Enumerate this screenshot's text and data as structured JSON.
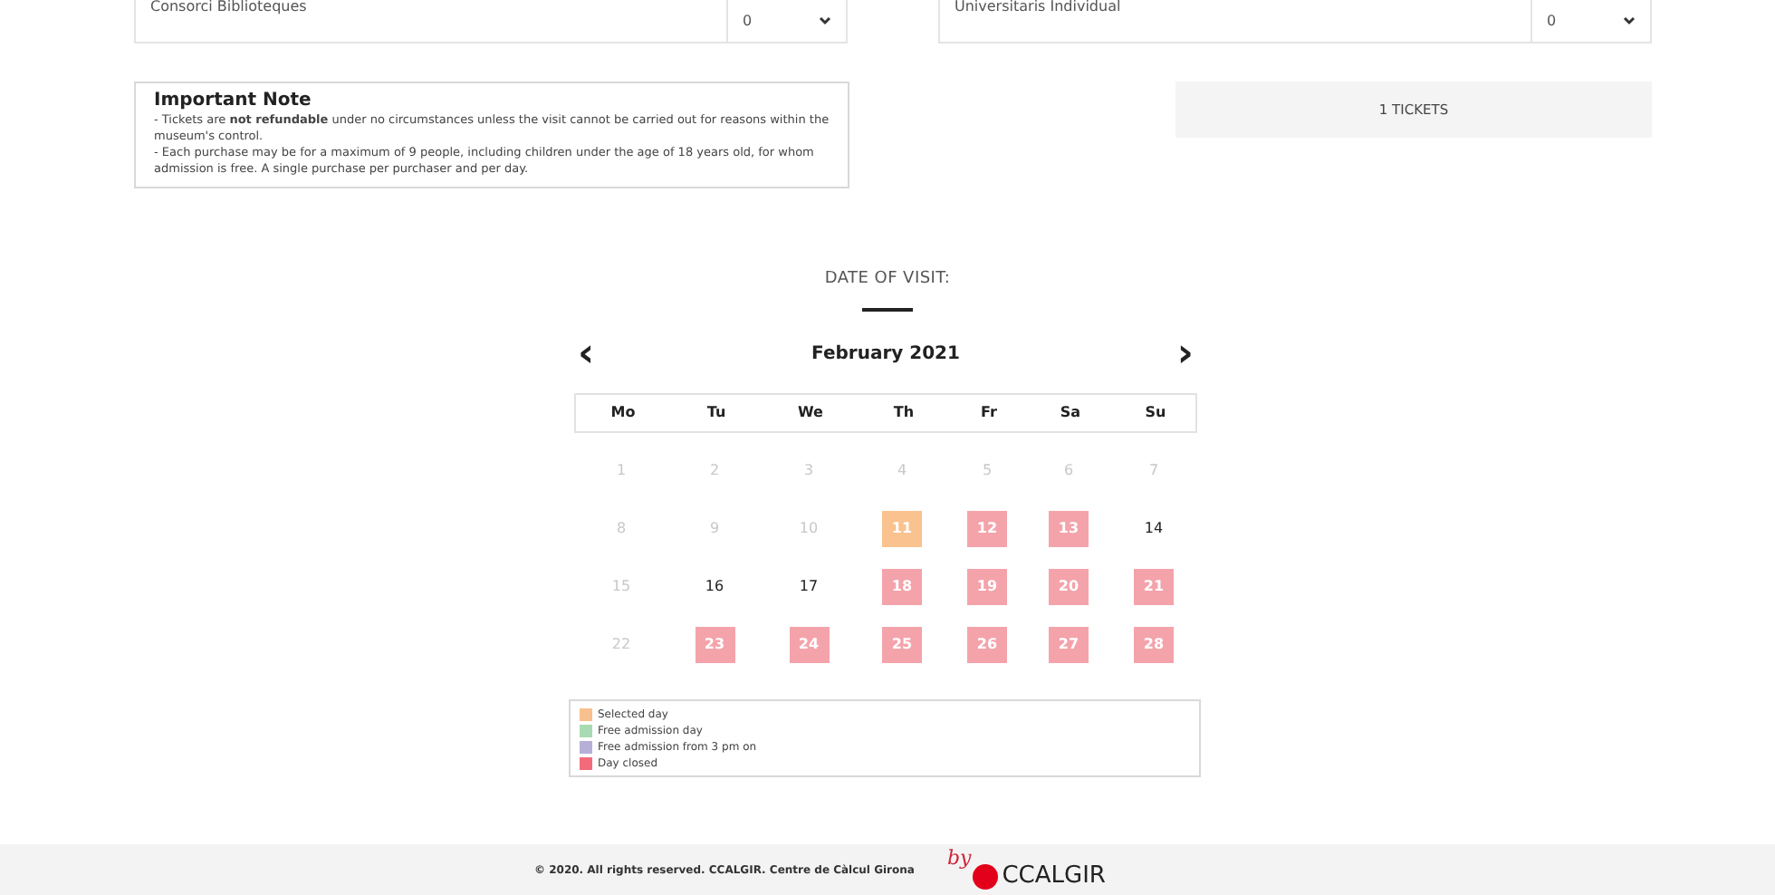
{
  "ticket_rows": [
    {
      "label": "Consorci Biblioteques",
      "quantity": "0"
    },
    {
      "label": "Universitaris Individual",
      "quantity": "0"
    }
  ],
  "note": {
    "title": "Important Note",
    "lines": [
      "- Tickets are **not refundable** under no circumstances unless the visit cannot be carried out for reasons within the museum's control.",
      "- Each purchase may be for a maximum of 9 people, including children under the age of 18 years old, for whom admission is free. A single purchase per purchaser and per day."
    ]
  },
  "ticket_total": "1 TICKETS",
  "date_heading": "DATE OF VISIT:",
  "calendar": {
    "prev": "‹",
    "month": "February 2021",
    "next": "›",
    "weekdays": [
      "Mo",
      "Tu",
      "We",
      "Th",
      "Fr",
      "Sa",
      "Su"
    ],
    "days": [
      {
        "day": "1",
        "kind": "past",
        "selected": false
      },
      {
        "day": "2",
        "kind": "past",
        "selected": false
      },
      {
        "day": "3",
        "kind": "past",
        "selected": false
      },
      {
        "day": "4",
        "kind": "past",
        "selected": false
      },
      {
        "day": "5",
        "kind": "past",
        "selected": false
      },
      {
        "day": "6",
        "kind": "past",
        "selected": false
      },
      {
        "day": "7",
        "kind": "past",
        "selected": false
      },
      {
        "day": "8",
        "kind": "past",
        "selected": false
      },
      {
        "day": "9",
        "kind": "past",
        "selected": false
      },
      {
        "day": "10",
        "kind": "past",
        "selected": false
      },
      {
        "day": "11",
        "kind": "open",
        "selected": true
      },
      {
        "day": "12",
        "kind": "closed",
        "selected": false
      },
      {
        "day": "13",
        "kind": "closed",
        "selected": false
      },
      {
        "day": "14",
        "kind": "open",
        "selected": false
      },
      {
        "day": "15",
        "kind": "past",
        "selected": false
      },
      {
        "day": "16",
        "kind": "open",
        "selected": false
      },
      {
        "day": "17",
        "kind": "open",
        "selected": false
      },
      {
        "day": "18",
        "kind": "closed",
        "selected": false
      },
      {
        "day": "19",
        "kind": "closed",
        "selected": false
      },
      {
        "day": "20",
        "kind": "closed",
        "selected": false
      },
      {
        "day": "21",
        "kind": "closed",
        "selected": false
      },
      {
        "day": "22",
        "kind": "past",
        "selected": false
      },
      {
        "day": "23",
        "kind": "closed",
        "selected": false
      },
      {
        "day": "24",
        "kind": "closed",
        "selected": false
      },
      {
        "day": "25",
        "kind": "closed",
        "selected": false
      },
      {
        "day": "26",
        "kind": "closed",
        "selected": false
      },
      {
        "day": "27",
        "kind": "closed",
        "selected": false
      },
      {
        "day": "28",
        "kind": "closed",
        "selected": false
      }
    ]
  },
  "legend": [
    {
      "label": "Selected day",
      "color": "#f8c08e"
    },
    {
      "label": "Free admission day",
      "color": "#a8dbb4"
    },
    {
      "label": "Free admission from 3 pm on",
      "color": "#b6b0d8"
    },
    {
      "label": "Day closed",
      "color": "#f36b7a"
    }
  ],
  "footer": {
    "copyright": "© 2020. All rights reserved. CCALGIR. Centre de Càlcul Girona",
    "by": "by",
    "brand": "CCALGIR"
  }
}
